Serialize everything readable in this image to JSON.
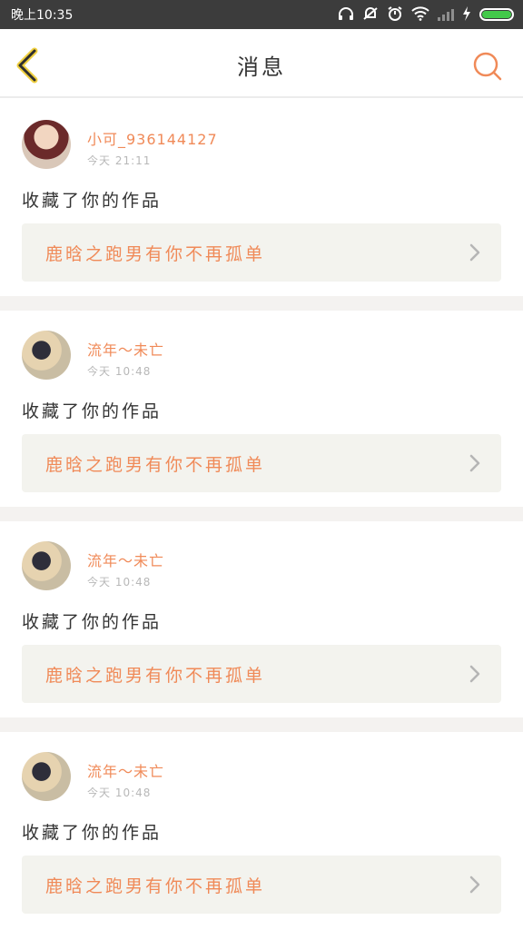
{
  "status_bar": {
    "time": "晚上10:35",
    "icons": [
      "headphones-icon",
      "muted-alarm-icon",
      "alarm-clock-icon",
      "wifi-icon",
      "signal-icon",
      "charging-icon",
      "battery-icon"
    ],
    "battery_color": "#43c94a"
  },
  "header": {
    "title": "消息",
    "back_icon": "chevron-left-icon",
    "search_icon": "search-icon",
    "accent_color": "#f08a58"
  },
  "messages": [
    {
      "user": "小可_936144127",
      "time": "今天 21:11",
      "avatar": "avatar-photo-1",
      "action": "收藏了你的作品",
      "work_title": "鹿晗之跑男有你不再孤单"
    },
    {
      "user": "流年～未亡",
      "time": "今天 10:48",
      "avatar": "avatar-photo-2",
      "action": "收藏了你的作品",
      "work_title": "鹿晗之跑男有你不再孤单"
    },
    {
      "user": "流年～未亡",
      "time": "今天 10:48",
      "avatar": "avatar-photo-2",
      "action": "收藏了你的作品",
      "work_title": "鹿晗之跑男有你不再孤单"
    },
    {
      "user": "流年～未亡",
      "time": "今天 10:48",
      "avatar": "avatar-photo-2",
      "action": "收藏了你的作品",
      "work_title": "鹿晗之跑男有你不再孤单"
    }
  ]
}
